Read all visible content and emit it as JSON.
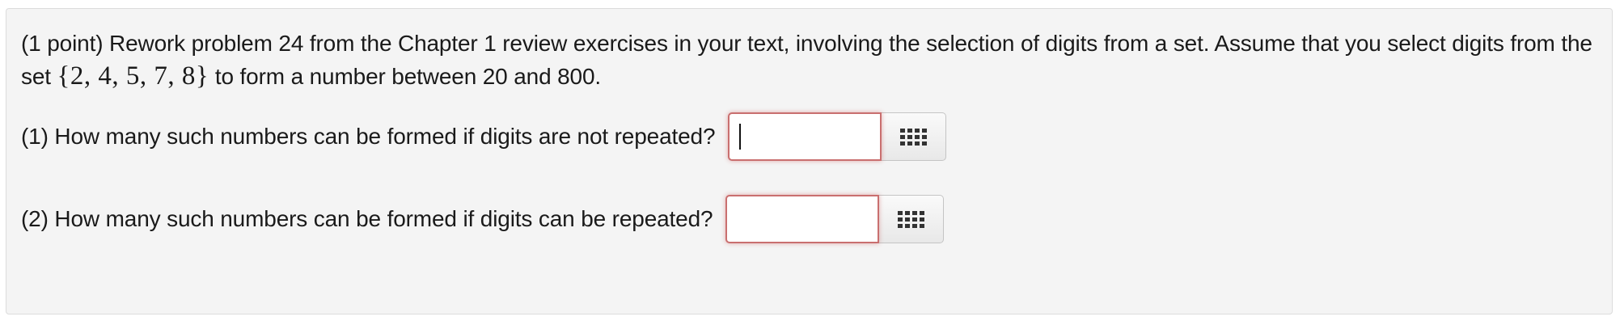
{
  "problem": {
    "points_label": "(1 point)",
    "intro_before_set": "Rework problem 24 from the Chapter 1 review exercises in your text, involving the selection of digits from a set. Assume that you select digits from the set",
    "digit_set": "{2, 4, 5, 7, 8}",
    "intro_after_set": "to form a number between 20 and 800."
  },
  "questions": [
    {
      "label": "(1) How many such numbers can be formed if digits are not repeated?",
      "answer_value": "",
      "focused": true,
      "keypad_icon": "keypad-grid-icon"
    },
    {
      "label": "(2) How many such numbers can be formed if digits can be repeated?",
      "answer_value": "",
      "focused": false,
      "keypad_icon": "keypad-grid-icon"
    }
  ],
  "colors": {
    "panel_background": "#f4f4f4",
    "invalid_border": "#c96f6f"
  }
}
